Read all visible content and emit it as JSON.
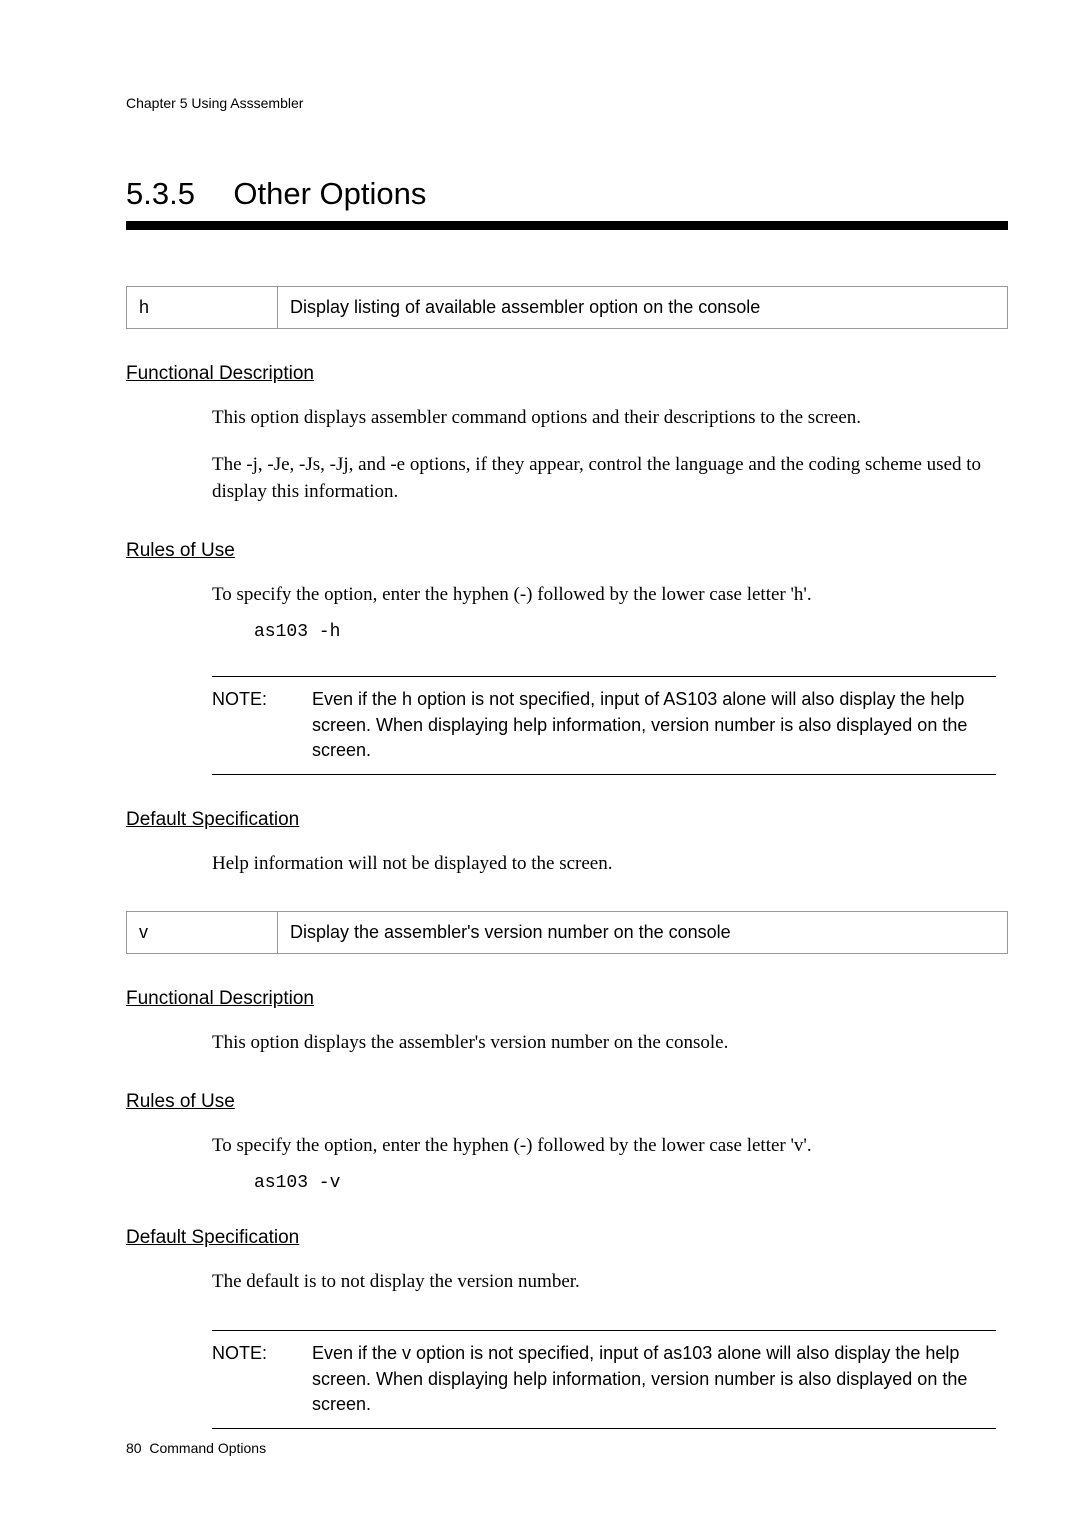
{
  "chapter_header": "Chapter  5   Using Asssembler",
  "section": {
    "number": "5.3.5",
    "title": "Other Options"
  },
  "h_option": {
    "flag": "h",
    "desc": "Display listing of available assembler option on the console",
    "func_desc_head": "Functional Description",
    "func_desc_p1": "This option displays assembler command options and their descriptions to the screen.",
    "func_desc_p2": "The -j, -Je, -Js, -Jj, and -e options, if they appear, control the language and the coding scheme used to display this information.",
    "rules_head": "Rules of Use",
    "rules_p1": "To specify the option, enter the hyphen (-) followed by the lower case letter 'h'.",
    "rules_code": "as103 -h",
    "note_label": "NOTE:",
    "note_text": "Even if the h option is not specified, input of AS103 alone will also display the help screen. When displaying help information, version number is also displayed on the screen.",
    "default_head": "Default Specification",
    "default_p1": "Help information will not be displayed to the screen."
  },
  "v_option": {
    "flag": "v",
    "desc": "Display the assembler's version number on the console",
    "func_desc_head": "Functional Description",
    "func_desc_p1": "This option displays the assembler's version number on the console.",
    "rules_head": "Rules of Use",
    "rules_p1": "To specify the option, enter the hyphen (-) followed by the lower case letter 'v'.",
    "rules_code": "as103 -v",
    "default_head": "Default Specification",
    "default_p1": "The default is to not display the version number.",
    "note_label": "NOTE:",
    "note_text": "Even if the v option is not specified, input of as103 alone will also display the help screen. When displaying help information, version number is also displayed on the screen."
  },
  "footer": {
    "page_num": "80",
    "footer_text": "Command Options"
  }
}
